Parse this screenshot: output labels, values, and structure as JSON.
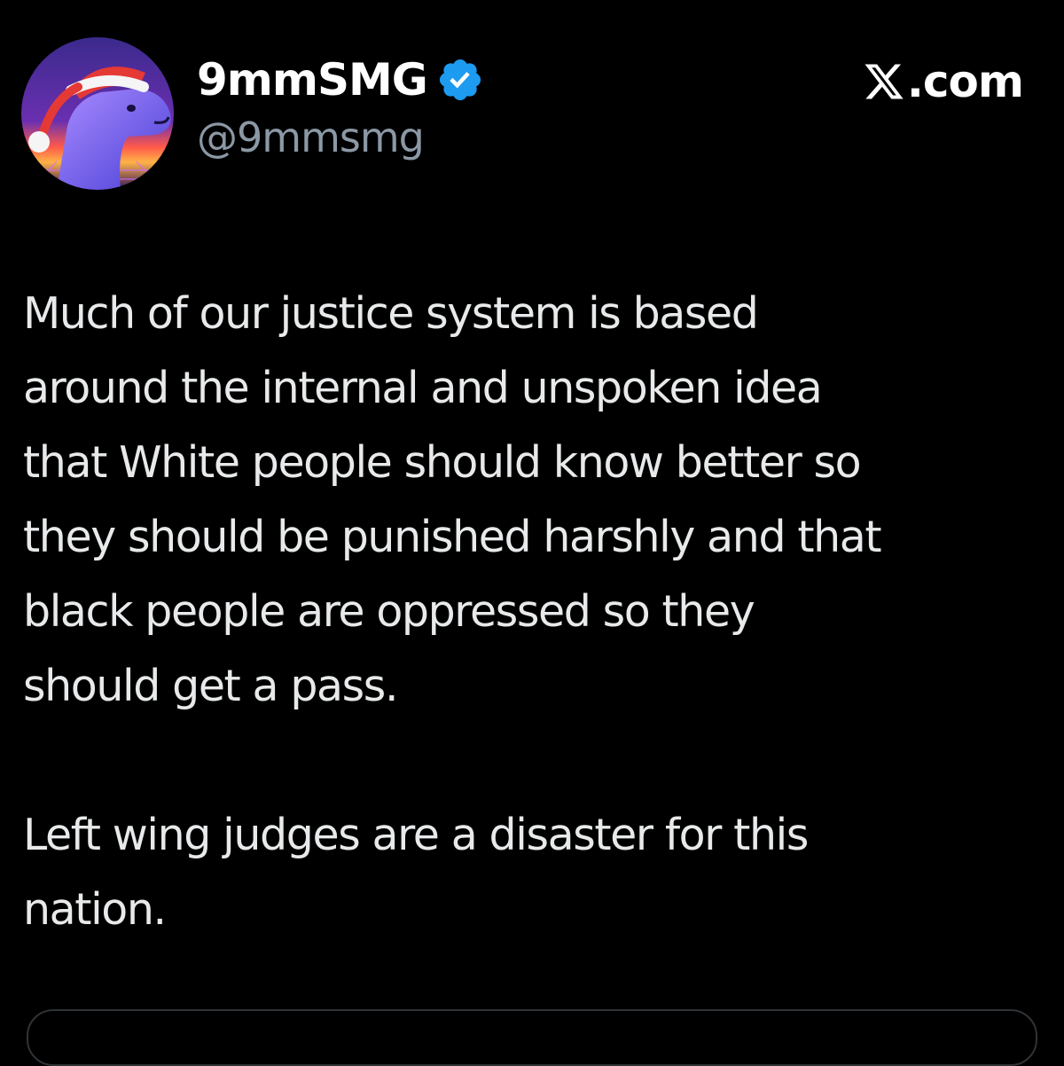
{
  "author": {
    "display_name": "9mmSMG",
    "handle": "@9mmsmg",
    "verified": true,
    "avatar_icon": "santa-dog-avatar-icon",
    "verified_icon": "verified-badge-icon"
  },
  "brand": {
    "logo_icon": "x-logo-icon",
    "text": ".com"
  },
  "post": {
    "paragraph_1": [
      "Much of our justice system is based",
      "around the internal and unspoken idea",
      "that White people should know better so",
      "they should be punished harshly and that",
      "black people are oppressed so they",
      "should get a pass."
    ],
    "paragraph_2": [
      "Left wing judges are a disaster for this",
      "nation."
    ]
  },
  "colors": {
    "background": "#000000",
    "text_primary": "#e7e9ea",
    "text_secondary": "#8b98a5",
    "verified_blue": "#1d9bf0"
  }
}
